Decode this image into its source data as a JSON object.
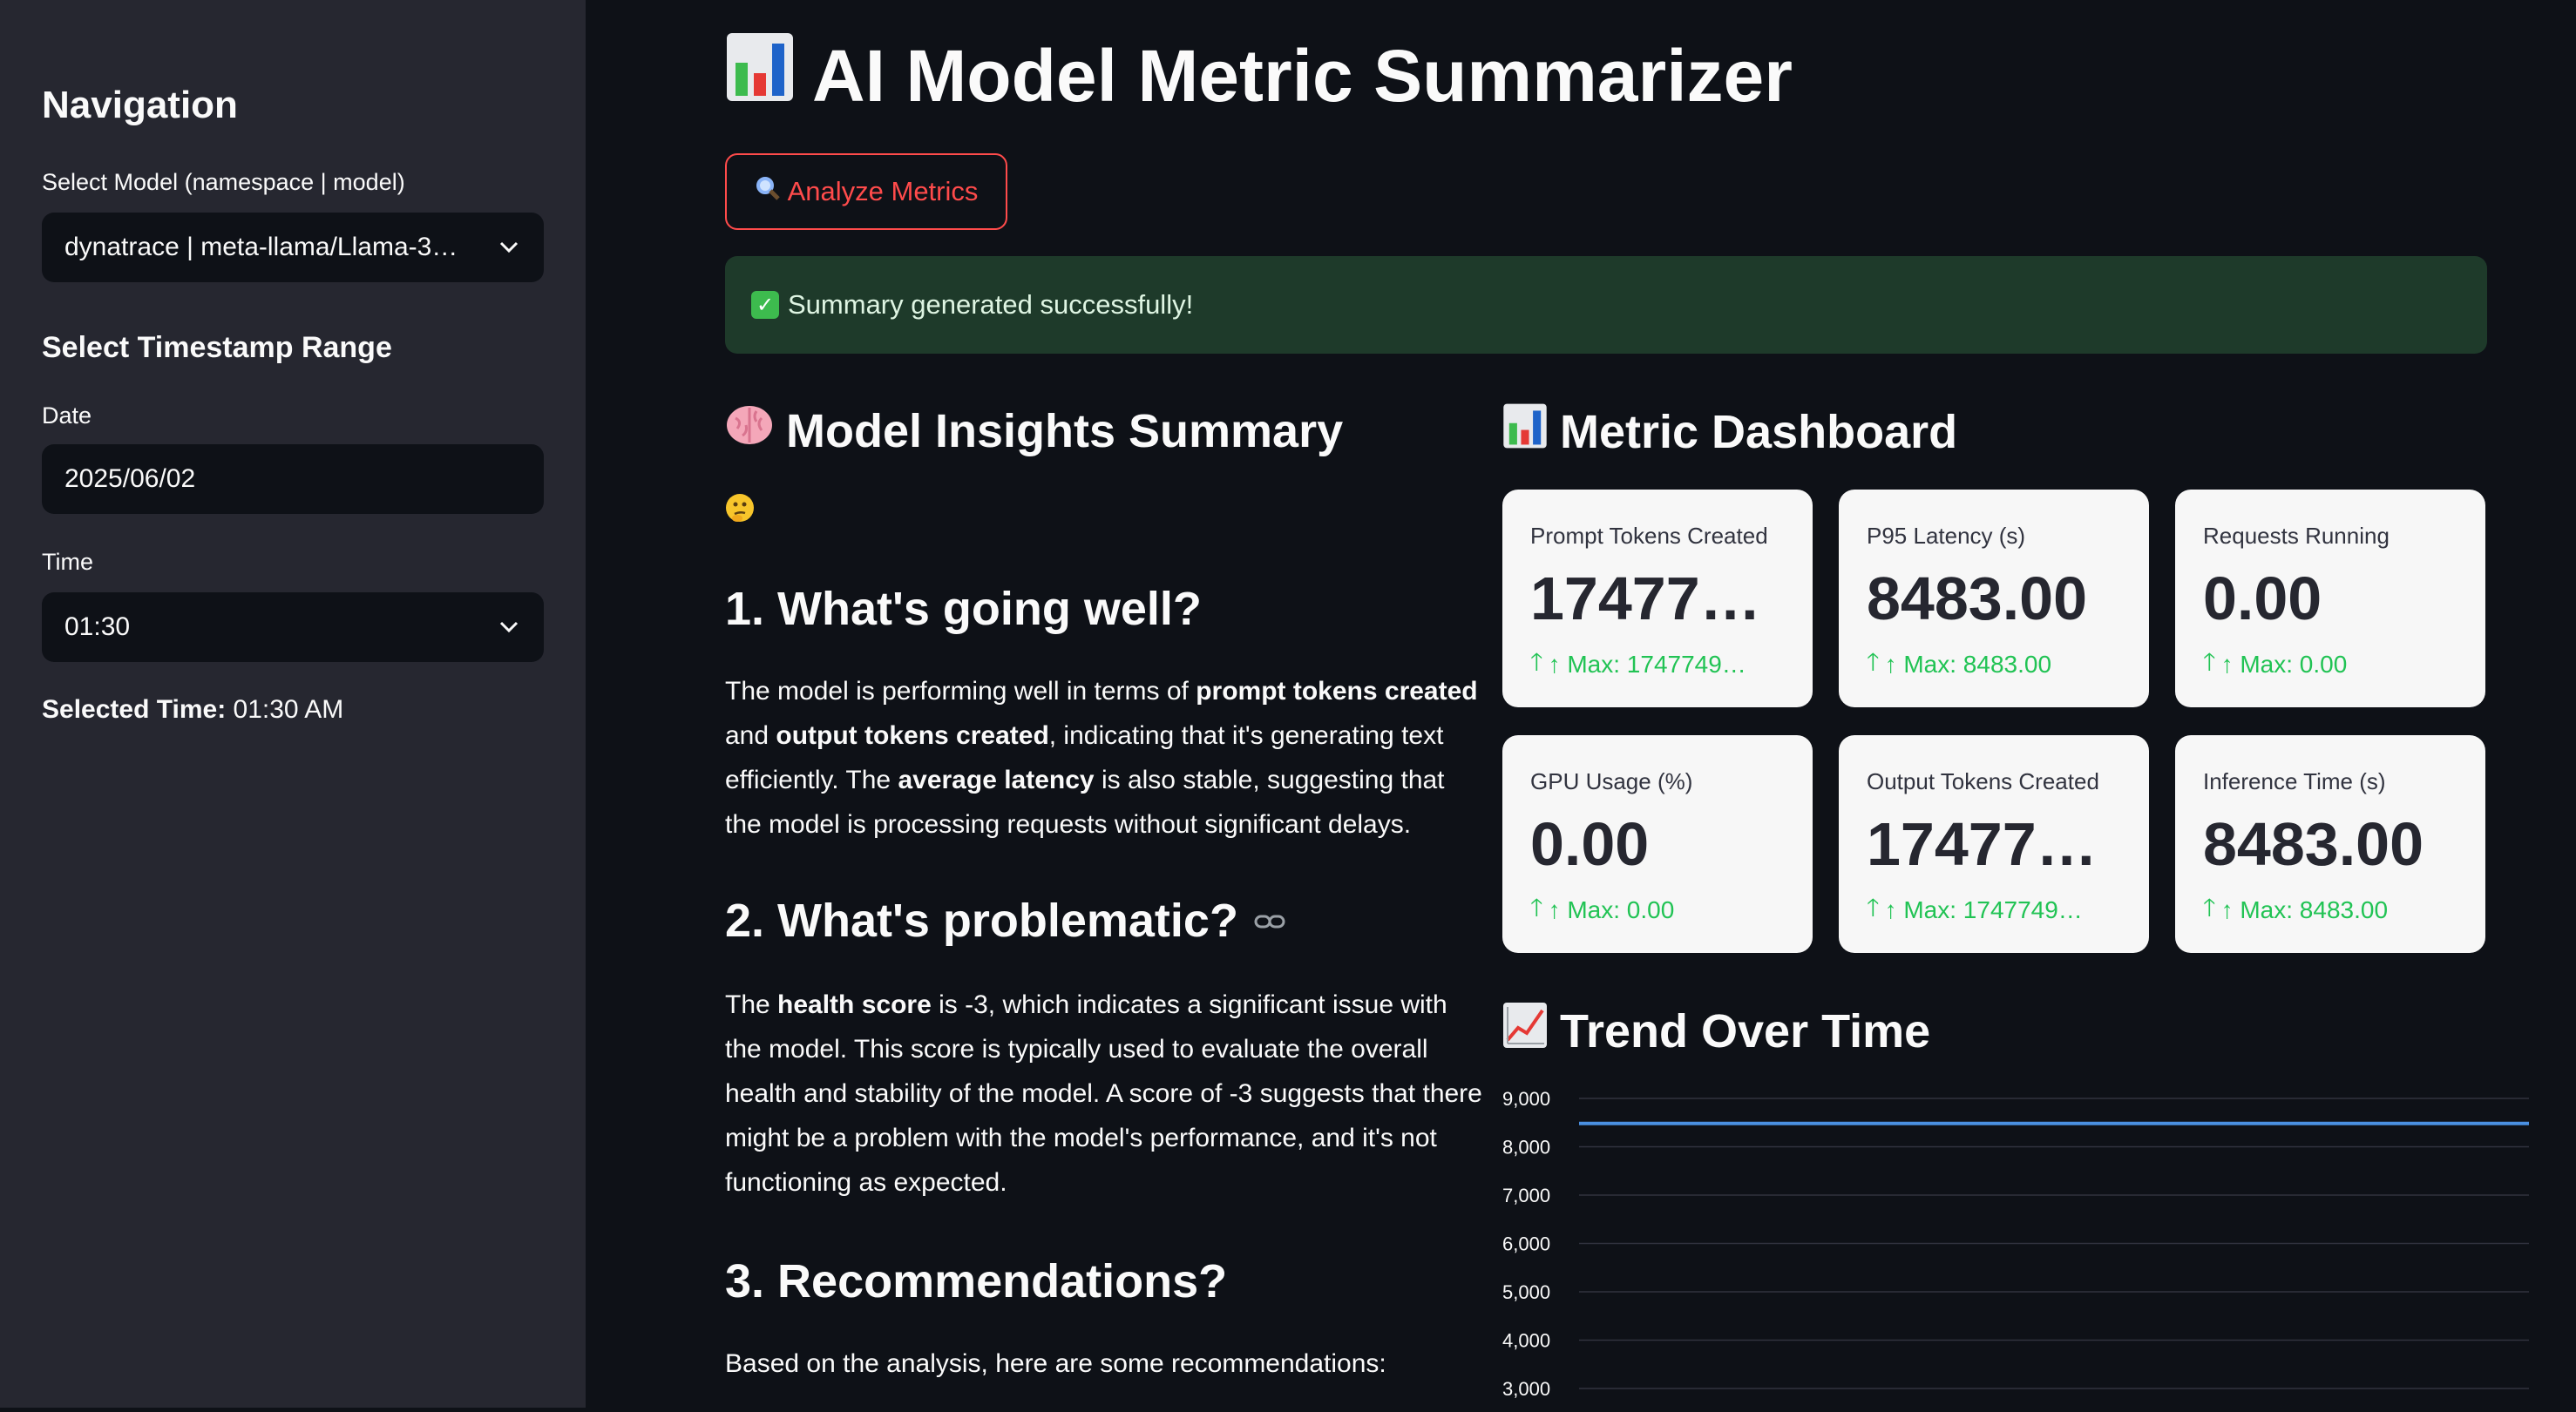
{
  "sidebar": {
    "title": "Navigation",
    "model_label": "Select Model (namespace | model)",
    "model_value": "dynatrace | meta-llama/Llama-3…",
    "range_heading": "Select Timestamp Range",
    "date_label": "Date",
    "date_value": "2025/06/02",
    "time_label": "Time",
    "time_value": "01:30",
    "selected_time_label": "Selected Time:",
    "selected_time_value": "01:30 AM"
  },
  "header": {
    "title_icon": "bar-chart-icon",
    "title": "AI Model Metric Summarizer"
  },
  "actions": {
    "analyze_icon": "magnifier-icon",
    "analyze_label": "Analyze Metrics"
  },
  "alert": {
    "icon": "check-mark-icon",
    "text": "Summary generated successfully!"
  },
  "summary": {
    "title_icon": "brain-icon",
    "title": "Model Insights Summary",
    "thinking_icon": "thinking-face-icon",
    "section1_title": "1. What's going well?",
    "section1_p1": "The model is performing well in terms of ",
    "section1_b1": "prompt tokens created",
    "section1_p2": " and ",
    "section1_b2": "output tokens created",
    "section1_p3": ", indicating that it's generating text efficiently. The ",
    "section1_b3": "average latency",
    "section1_p4": " is also stable, suggesting that the model is processing requests without significant delays.",
    "section2_title": "2. What's problematic?",
    "section2_p1": "The ",
    "section2_b1": "health score",
    "section2_p2": " is -3, which indicates a significant issue with the model. This score is typically used to evaluate the overall health and stability of the model. A score of -3 suggests that there might be a problem with the model's performance, and it's not functioning as expected.",
    "section3_title": "3. Recommendations?",
    "section3_p1": "Based on the analysis, here are some recommendations:"
  },
  "dashboard": {
    "title_icon": "bar-chart-icon",
    "title": "Metric Dashboard",
    "cards": [
      {
        "label": "Prompt Tokens Created",
        "value": "17477…",
        "delta": "↑ Max: 1747749…"
      },
      {
        "label": "P95 Latency (s)",
        "value": "8483.00",
        "delta": "↑ Max: 8483.00"
      },
      {
        "label": "Requests Running",
        "value": "0.00",
        "delta": "↑ Max: 0.00"
      },
      {
        "label": "GPU Usage (%)",
        "value": "0.00",
        "delta": "↑ Max: 0.00"
      },
      {
        "label": "Output Tokens Created",
        "value": "17477…",
        "delta": "↑ Max: 1747749…"
      },
      {
        "label": "Inference Time (s)",
        "value": "8483.00",
        "delta": "↑ Max: 8483.00"
      }
    ],
    "colors": {
      "delta": "#21c354",
      "card_bg": "#f7f7f7"
    }
  },
  "trend": {
    "title_icon": "chart-increasing-icon",
    "title": "Trend Over Time"
  },
  "chart_data": {
    "type": "line",
    "title": "",
    "xlabel": "",
    "ylabel": "",
    "y_ticks": [
      "9,000",
      "8,000",
      "7,000",
      "6,000",
      "5,000",
      "4,000",
      "3,000"
    ],
    "ylim": [
      3000,
      9000
    ],
    "series": [
      {
        "values": [
          8483,
          8483
        ],
        "color": "#4a90e2"
      }
    ],
    "grid": true
  }
}
